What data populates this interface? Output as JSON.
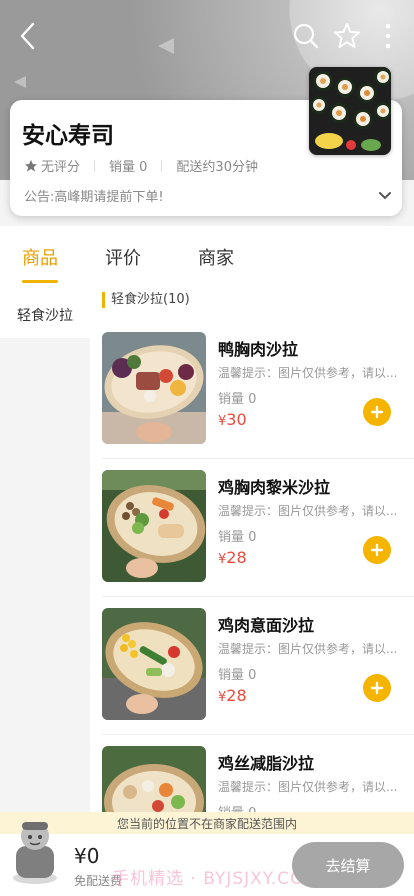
{
  "header": {
    "icons": [
      "back-icon",
      "search-icon",
      "star-icon",
      "more-icon"
    ]
  },
  "shop": {
    "name": "安心寿司",
    "rating": "无评分",
    "sales": "销量 0",
    "delivery": "配送约30分钟",
    "notice": "公告:高峰期请提前下单!"
  },
  "tabs": [
    {
      "label": "商品",
      "active": true
    },
    {
      "label": "评价",
      "active": false
    },
    {
      "label": "商家",
      "active": false
    }
  ],
  "sidebar": {
    "items": [
      {
        "label": "轻食沙拉"
      }
    ]
  },
  "category": {
    "title": "轻食沙拉(10)"
  },
  "items": [
    {
      "name": "鸭胸肉沙拉",
      "tip": "温馨提示：图片仅供参考，请以...",
      "sales": "销量 0",
      "currency": "¥",
      "price": "30"
    },
    {
      "name": "鸡胸肉黎米沙拉",
      "tip": "温馨提示：图片仅供参考，请以...",
      "sales": "销量 0",
      "currency": "¥",
      "price": "28"
    },
    {
      "name": "鸡肉意面沙拉",
      "tip": "温馨提示：图片仅供参考，请以...",
      "sales": "销量 0",
      "currency": "¥",
      "price": "28"
    },
    {
      "name": "鸡丝减脂沙拉",
      "tip": "温馨提示：图片仅供参考，请以...",
      "sales": "销量 0",
      "currency": "¥",
      "price": ""
    }
  ],
  "warning": "您当前的位置不在商家配送范围内",
  "cart": {
    "total": "¥0",
    "free_delivery": "免配送费",
    "checkout_label": "去结算",
    "watermark": "手机精选 · BYJSJXY.COM"
  },
  "colors": {
    "accent": "#f0b400",
    "price": "#e94b3c",
    "checkout": "#a7a7a7"
  }
}
